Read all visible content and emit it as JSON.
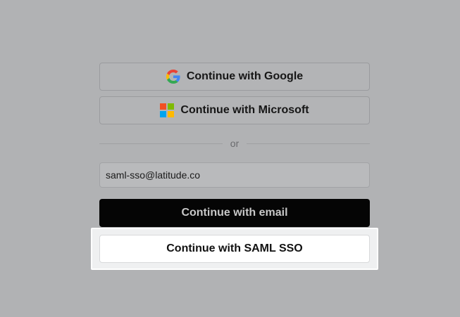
{
  "auth": {
    "google_label": "Continue with Google",
    "microsoft_label": "Continue with Microsoft",
    "divider_text": "or",
    "email_value": "saml-sso@latitude.co",
    "email_button_label": "Continue with email",
    "saml_button_label": "Continue with SAML SSO"
  },
  "icons": {
    "google": "google-logo-icon",
    "microsoft": "microsoft-logo-icon"
  },
  "colors": {
    "background": "#b1b2b4",
    "primary_button": "#050505",
    "highlight": "#ffffff",
    "microsoft_red": "#f25022",
    "microsoft_green": "#7fba00",
    "microsoft_blue": "#00a4ef",
    "microsoft_yellow": "#ffb900"
  }
}
